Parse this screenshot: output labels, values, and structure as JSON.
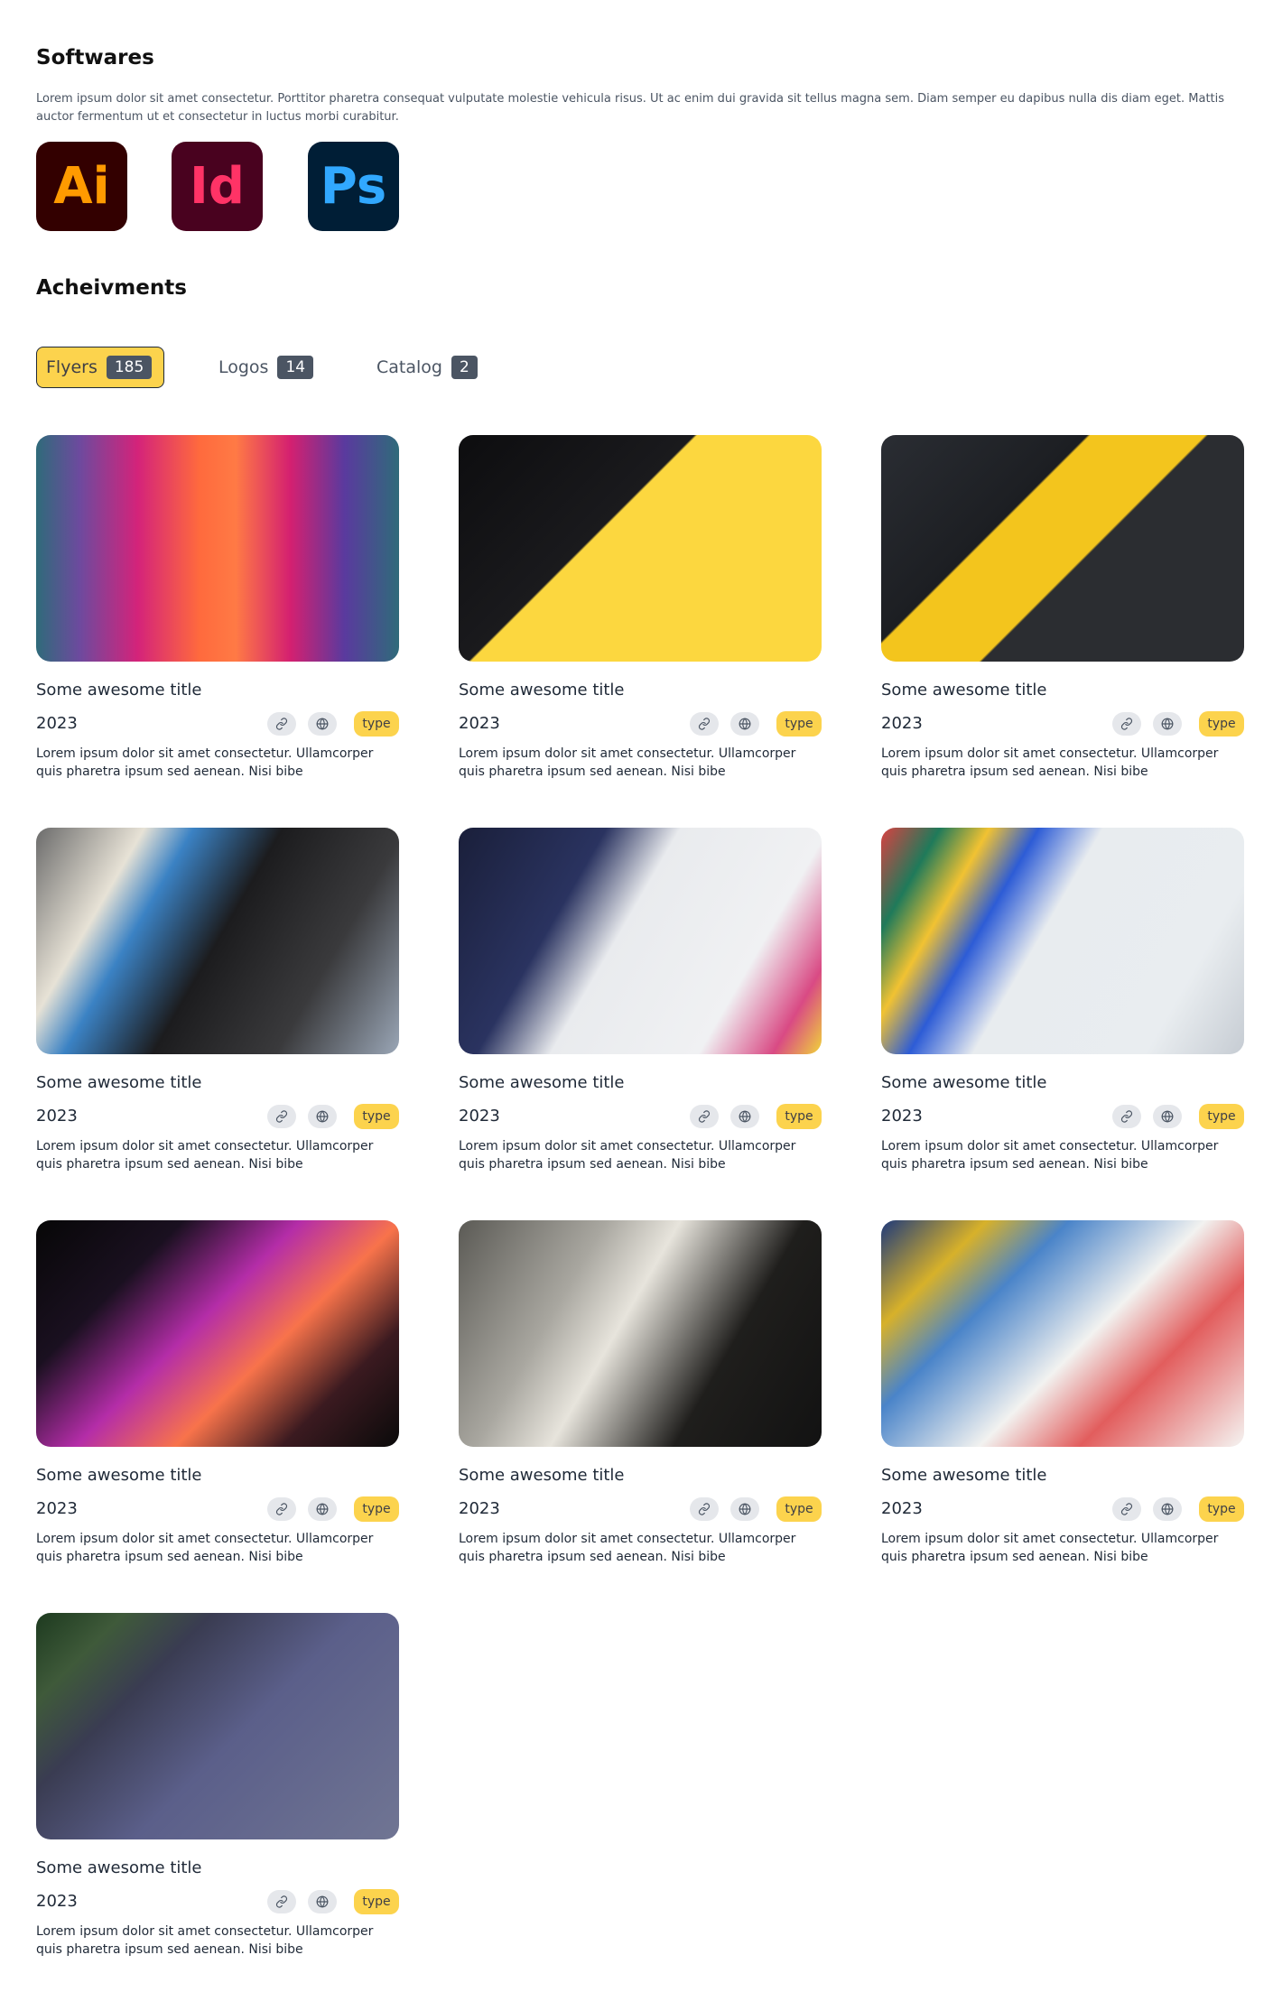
{
  "softwares": {
    "title": "Softwares",
    "description": "Lorem ipsum dolor sit amet consectetur. Porttitor pharetra consequat vulputate molestie vehicula risus. Ut ac enim dui gravida sit tellus magna sem. Diam semper eu dapibus nulla dis diam eget. Mattis auctor fermentum ut et consectetur in luctus morbi curabitur.",
    "apps": [
      {
        "label": "Ai",
        "name": "adobe-illustrator-icon",
        "bg": "#330000",
        "fg": "#ff9a00"
      },
      {
        "label": "Id",
        "name": "adobe-indesign-icon",
        "bg": "#49021f",
        "fg": "#ff3366"
      },
      {
        "label": "Ps",
        "name": "adobe-photoshop-icon",
        "bg": "#001e36",
        "fg": "#31a8ff"
      }
    ]
  },
  "achievements": {
    "title": "Acheivments",
    "tabs": [
      {
        "label": "Flyers",
        "count": "185",
        "active": true
      },
      {
        "label": "Logos",
        "count": "14",
        "active": false
      },
      {
        "label": "Catalog",
        "count": "2",
        "active": false
      }
    ]
  },
  "cards": [
    {
      "title": "Some awesome title",
      "year": "2023",
      "badge": "type",
      "description": "Lorem ipsum dolor sit amet consectetur. Ullamcorper quis pharetra ipsum sed aenean. Nisi bibe",
      "image": "neon-corridor-photo"
    },
    {
      "title": "Some awesome title",
      "year": "2023",
      "badge": "type",
      "description": "Lorem ipsum dolor sit amet consectetur. Ullamcorper quis pharetra ipsum sed aenean. Nisi bibe",
      "image": "keyboard-tablet-yellow-photo"
    },
    {
      "title": "Some awesome title",
      "year": "2023",
      "badge": "type",
      "description": "Lorem ipsum dolor sit amet consectetur. Ullamcorper quis pharetra ipsum sed aenean. Nisi bibe",
      "image": "camera-phone-desk-photo"
    },
    {
      "title": "Some awesome title",
      "year": "2023",
      "badge": "type",
      "description": "Lorem ipsum dolor sit amet consectetur. Ullamcorper quis pharetra ipsum sed aenean. Nisi bibe",
      "image": "laptop-desk-lamp-photo"
    },
    {
      "title": "Some awesome title",
      "year": "2023",
      "badge": "type",
      "description": "Lorem ipsum dolor sit amet consectetur. Ullamcorper quis pharetra ipsum sed aenean. Nisi bibe",
      "image": "drawing-tablet-photo"
    },
    {
      "title": "Some awesome title",
      "year": "2023",
      "badge": "type",
      "description": "Lorem ipsum dolor sit amet consectetur. Ullamcorper quis pharetra ipsum sed aenean. Nisi bibe",
      "image": "macbook-colorful-wall-photo"
    },
    {
      "title": "Some awesome title",
      "year": "2023",
      "badge": "type",
      "description": "Lorem ipsum dolor sit amet consectetur. Ullamcorper quis pharetra ipsum sed aenean. Nisi bibe",
      "image": "backlit-keyboard-photo"
    },
    {
      "title": "Some awesome title",
      "year": "2023",
      "badge": "type",
      "description": "Lorem ipsum dolor sit amet consectetur. Ullamcorper quis pharetra ipsum sed aenean. Nisi bibe",
      "image": "sketching-tablet-mug-photo"
    },
    {
      "title": "Some awesome title",
      "year": "2023",
      "badge": "type",
      "description": "Lorem ipsum dolor sit amet consectetur. Ullamcorper quis pharetra ipsum sed aenean. Nisi bibe",
      "image": "color-swatches-photo"
    },
    {
      "title": "Some awesome title",
      "year": "2023",
      "badge": "type",
      "description": "Lorem ipsum dolor sit amet consectetur. Ullamcorper quis pharetra ipsum sed aenean. Nisi bibe",
      "image": "adobe-apps-tablet-photo"
    }
  ]
}
